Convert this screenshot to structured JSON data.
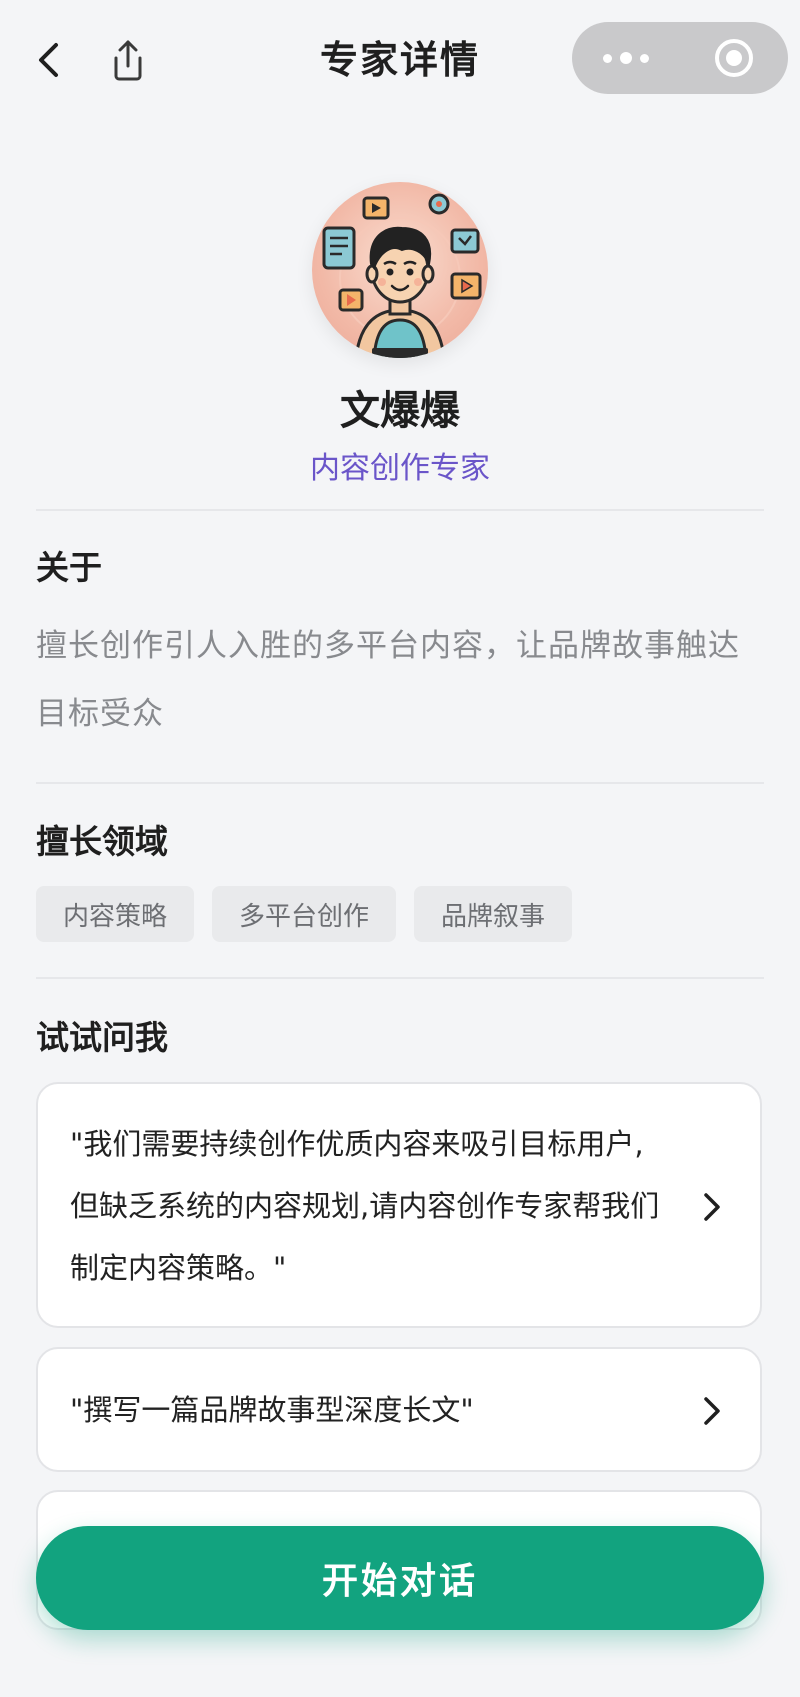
{
  "header": {
    "title": "专家详情",
    "back_icon": "chevron-left-icon",
    "share_icon": "share-icon",
    "more_icon": "more-dots-icon",
    "close_icon": "target-circle-icon"
  },
  "profile": {
    "name": "文爆爆",
    "role": "内容创作专家",
    "role_color": "#6a55c9"
  },
  "about": {
    "title": "关于",
    "text": "擅长创作引人入胜的多平台内容，让品牌故事触达目标受众"
  },
  "expertise": {
    "title": "擅长领域",
    "tags": [
      "内容策略",
      "多平台创作",
      "品牌叙事"
    ]
  },
  "ask": {
    "title": "试试问我",
    "prompts": [
      "\"我们需要持续创作优质内容来吸引目标用户,但缺乏系统的内容规划,请内容创作专家帮我们制定内容策略。\"",
      "\"撰写一篇品牌故事型深度长文\"",
      ""
    ]
  },
  "cta": {
    "label": "开始对话",
    "color": "#12a37f"
  }
}
